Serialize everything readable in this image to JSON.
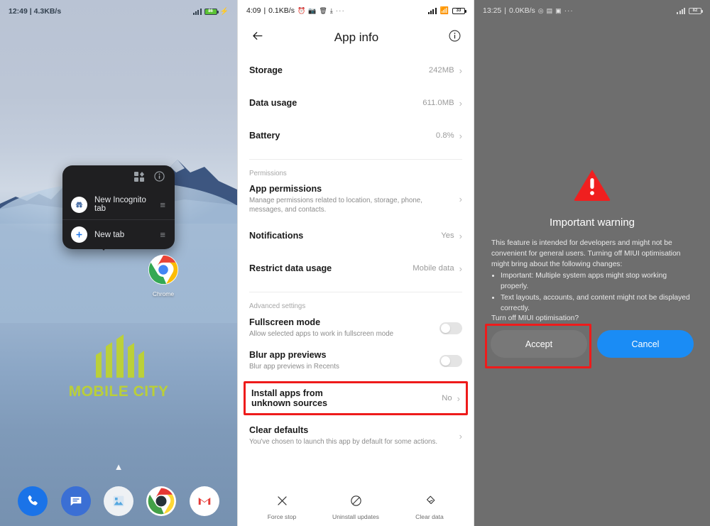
{
  "panel_home": {
    "status": {
      "time": "12:49",
      "net_speed": "4.3KB/s",
      "separator": "|",
      "battery_pct": "86"
    },
    "context_menu": {
      "widget_icon": "widgets-icon",
      "info_icon": "info-circle-icon",
      "items": [
        {
          "label": "New Incognito tab",
          "icon": "incognito-icon",
          "handle": "drag-handle-icon"
        },
        {
          "label": "New tab",
          "icon": "plus-icon",
          "handle": "drag-handle-icon"
        }
      ]
    },
    "app_icon": {
      "name": "chrome-icon",
      "label": "Chrome"
    },
    "watermark": {
      "text": "MOBILE CITY",
      "color": "#c2d626"
    },
    "drawer_arrow": "▲",
    "dock": [
      {
        "name": "phone-icon",
        "color": "#1a73e8"
      },
      {
        "name": "messages-icon",
        "color": "#3b6fd4"
      },
      {
        "name": "gallery-icon",
        "color": "#eef1f4"
      },
      {
        "name": "chrome-icon",
        "color": "#ffffff"
      },
      {
        "name": "gmail-icon",
        "color": "#ffffff"
      }
    ]
  },
  "panel_appinfo": {
    "status": {
      "time": "4:09",
      "net_speed": "0.1KB/s",
      "separator": "|",
      "battery_pct": "33",
      "icons": [
        "alarm-icon",
        "camera-icon",
        "trash-icon",
        "download-icon",
        "more-icon"
      ]
    },
    "appbar": {
      "back_icon": "back-arrow-icon",
      "title": "App info",
      "info_icon": "info-circle-icon"
    },
    "rows": [
      {
        "title": "Storage",
        "subtitle": "",
        "value": "242MB",
        "type": "chevron"
      },
      {
        "title": "Data usage",
        "subtitle": "",
        "value": "611.0MB",
        "type": "chevron"
      },
      {
        "title": "Battery",
        "subtitle": "",
        "value": "0.8%",
        "type": "chevron"
      }
    ],
    "section_permissions": "Permissions",
    "rows_permissions": [
      {
        "title": "App permissions",
        "subtitle": "Manage permissions related to location, storage, phone, messages, and contacts.",
        "value": "",
        "type": "chevron"
      },
      {
        "title": "Notifications",
        "subtitle": "",
        "value": "Yes",
        "type": "chevron"
      },
      {
        "title": "Restrict data usage",
        "subtitle": "",
        "value": "Mobile data",
        "type": "chevron"
      }
    ],
    "section_advanced": "Advanced settings",
    "rows_advanced": [
      {
        "title": "Fullscreen mode",
        "subtitle": "Allow selected apps to work in fullscreen mode",
        "value": "",
        "type": "toggle",
        "toggle_on": false
      },
      {
        "title": "Blur app previews",
        "subtitle": "Blur app previews in Recents",
        "value": "",
        "type": "toggle",
        "toggle_on": false
      }
    ],
    "highlighted_row": {
      "title_line1": "Install apps from",
      "title_line2": "unknown sources",
      "value": "No",
      "type": "chevron",
      "highlight_color": "#ee1b1b"
    },
    "row_clear_defaults": {
      "title": "Clear defaults",
      "subtitle": "You've chosen to launch this app by default for some actions.",
      "value": "",
      "type": "chevron"
    },
    "actions": [
      {
        "label": "Force stop",
        "icon": "close-x-icon"
      },
      {
        "label": "Uninstall updates",
        "icon": "block-circle-icon"
      },
      {
        "label": "Clear data",
        "icon": "eraser-icon"
      }
    ]
  },
  "panel_warning": {
    "status": {
      "time": "13:25",
      "net_speed": "0.0KB/s",
      "separator": "|",
      "battery_pct": "82",
      "icons": [
        "whatsapp-icon",
        "archive-icon",
        "news-icon",
        "more-icon"
      ]
    },
    "dialog": {
      "icon": "warning-triangle-icon",
      "icon_color": "#f01f1f",
      "title": "Important warning",
      "intro": "This feature is intended for developers and might not be convenient for general users. Turning off MIUI optimisation might bring about the following changes:",
      "bullets": [
        "Important: Multiple system apps might stop working properly.",
        "Text layouts, accounts, and content might not be displayed correctly."
      ],
      "question": "Turn off MIUI optimisation?",
      "accept_label": "Accept",
      "cancel_label": "Cancel",
      "cancel_color": "#1a8cf5",
      "highlight_color": "#ee1b1b"
    }
  }
}
